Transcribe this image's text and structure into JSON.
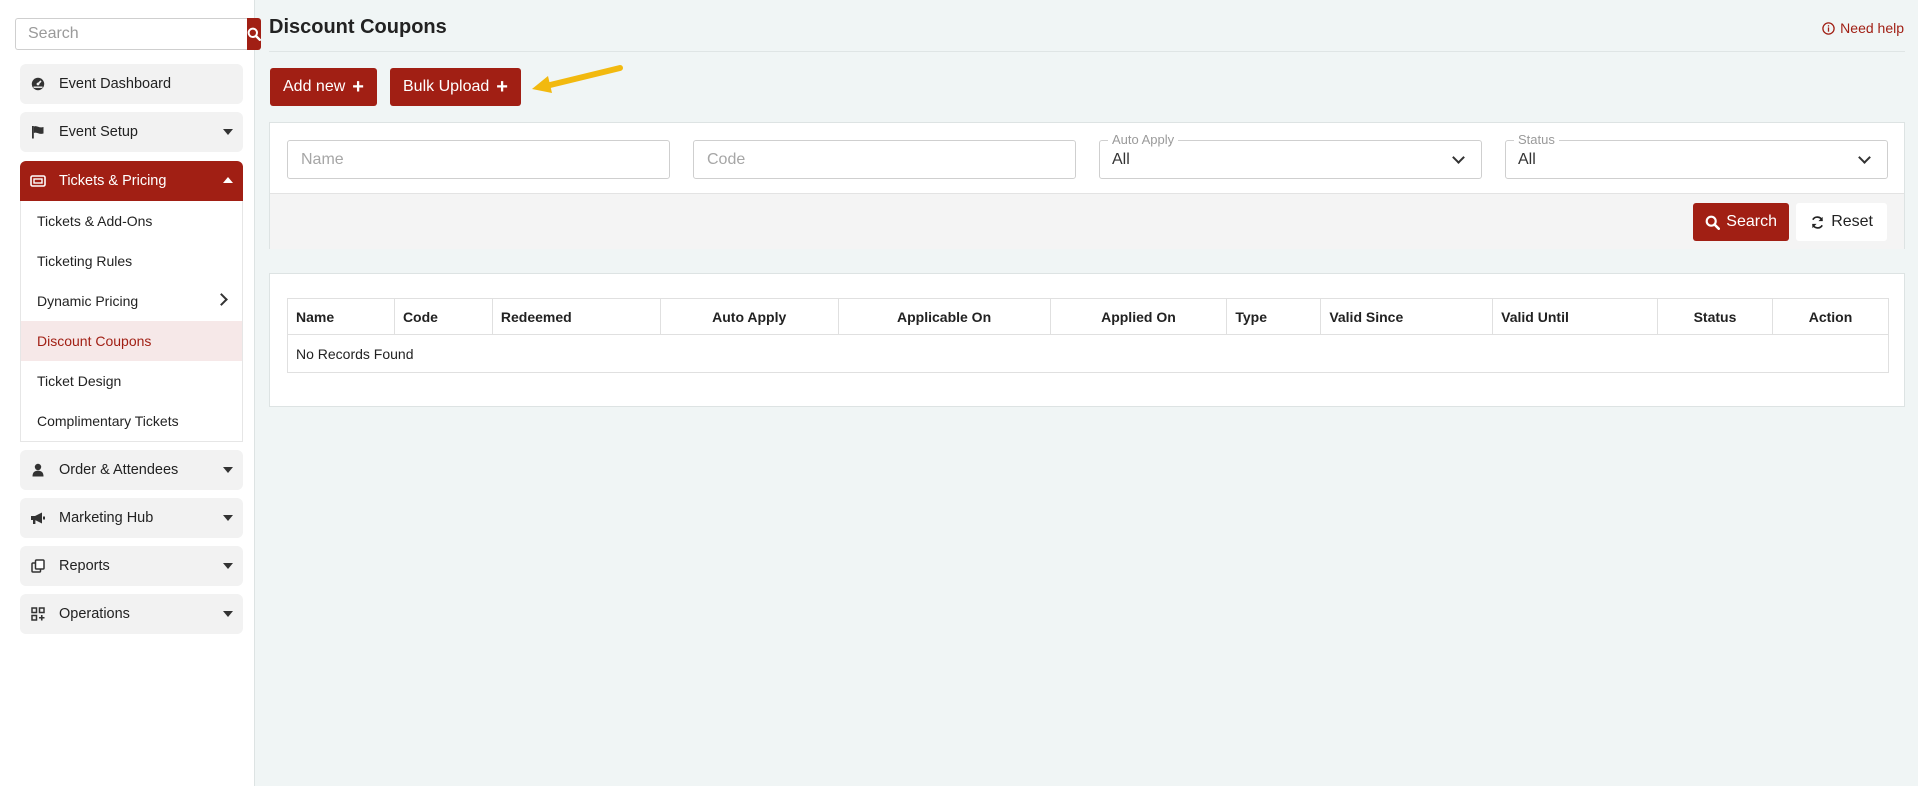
{
  "sidebar": {
    "search_placeholder": "Search",
    "items": [
      {
        "label": "Event Dashboard",
        "icon": "dashboard-icon"
      },
      {
        "label": "Event Setup",
        "icon": "flag-icon"
      },
      {
        "label": "Tickets & Pricing",
        "icon": "ticket-icon"
      },
      {
        "label": "Order & Attendees",
        "icon": "user-icon"
      },
      {
        "label": "Marketing Hub",
        "icon": "megaphone-icon"
      },
      {
        "label": "Reports",
        "icon": "copy-icon"
      },
      {
        "label": "Operations",
        "icon": "grid-plus-icon"
      }
    ],
    "submenu": [
      {
        "label": "Tickets & Add-Ons"
      },
      {
        "label": "Ticketing Rules"
      },
      {
        "label": "Dynamic Pricing"
      },
      {
        "label": "Discount Coupons"
      },
      {
        "label": "Ticket Design"
      },
      {
        "label": "Complimentary Tickets"
      }
    ]
  },
  "header": {
    "title": "Discount Coupons",
    "help": "Need help"
  },
  "actions": {
    "add_new": "Add new",
    "bulk_upload": "Bulk Upload"
  },
  "filters": {
    "name_placeholder": "Name",
    "code_placeholder": "Code",
    "auto_apply_label": "Auto Apply",
    "auto_apply_value": "All",
    "status_label": "Status",
    "status_value": "All",
    "search": "Search",
    "reset": "Reset"
  },
  "table": {
    "columns": [
      "Name",
      "Code",
      "Redeemed",
      "Auto Apply",
      "Applicable On",
      "Applied On",
      "Type",
      "Valid Since",
      "Valid Until",
      "Status",
      "Action"
    ],
    "empty": "No Records Found"
  },
  "colors": {
    "accent": "#a11f14",
    "annotation_arrow": "#f2b90f"
  }
}
